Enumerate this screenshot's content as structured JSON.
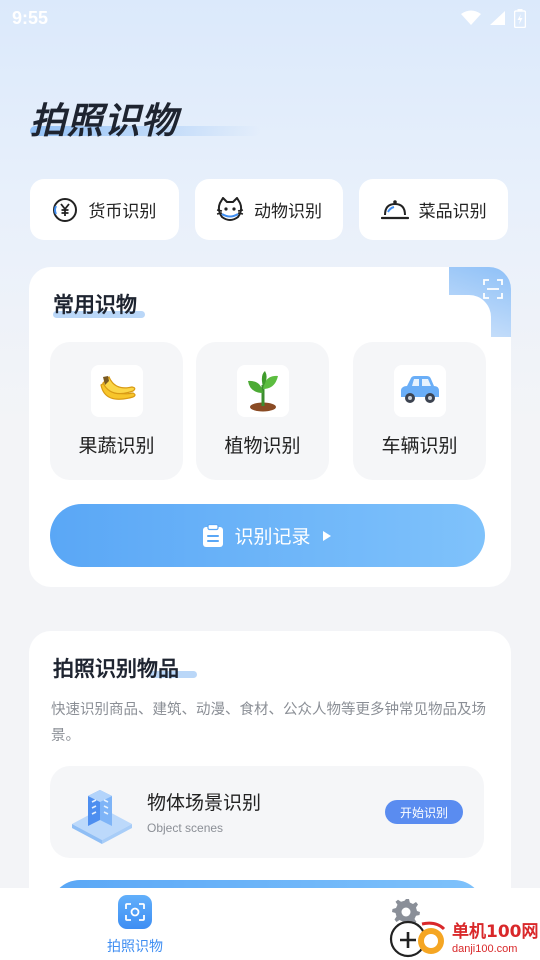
{
  "status": {
    "time": "9:55"
  },
  "title": "拍照识物",
  "quick_actions": [
    {
      "label": "货币识别",
      "icon": "currency-icon"
    },
    {
      "label": "动物识别",
      "icon": "cat-icon"
    },
    {
      "label": "菜品识别",
      "icon": "dish-cloche-icon"
    }
  ],
  "common": {
    "title": "常用识物",
    "items": [
      {
        "label": "果蔬识别",
        "icon": "banana-icon"
      },
      {
        "label": "植物识别",
        "icon": "sprout-icon"
      },
      {
        "label": "车辆识别",
        "icon": "car-icon"
      }
    ],
    "record_label": "识别记录"
  },
  "photo": {
    "title": "拍照识别物品",
    "description": "快速识别商品、建筑、动漫、食材、公众人物等更多钟常见物品及场景。",
    "scene_title": "物体场景识别",
    "scene_subtitle": "Object scenes",
    "start_label": "开始识别"
  },
  "tabbar": {
    "home_label": "拍照识物",
    "settings_label": "设置"
  },
  "watermark": {
    "cn": "单机100网",
    "en": "danji100.com"
  },
  "colors": {
    "accent": "#3f8ef2",
    "start_button": "#5a8cf0",
    "brand_red": "#d9282a"
  }
}
